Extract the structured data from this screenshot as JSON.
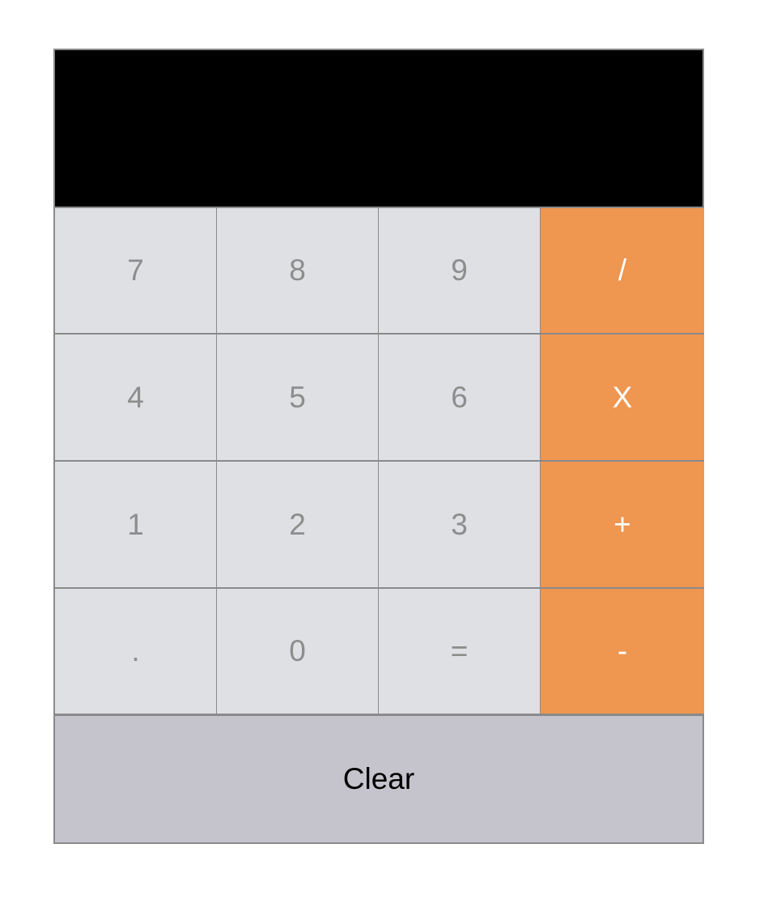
{
  "display": {
    "value": ""
  },
  "keys": [
    {
      "label": "7",
      "kind": "digit",
      "name": "key-7"
    },
    {
      "label": "8",
      "kind": "digit",
      "name": "key-8"
    },
    {
      "label": "9",
      "kind": "digit",
      "name": "key-9"
    },
    {
      "label": "/",
      "kind": "op",
      "name": "divide-button"
    },
    {
      "label": "4",
      "kind": "digit",
      "name": "key-4"
    },
    {
      "label": "5",
      "kind": "digit",
      "name": "key-5"
    },
    {
      "label": "6",
      "kind": "digit",
      "name": "key-6"
    },
    {
      "label": "X",
      "kind": "op",
      "name": "multiply-button"
    },
    {
      "label": "1",
      "kind": "digit",
      "name": "key-1"
    },
    {
      "label": "2",
      "kind": "digit",
      "name": "key-2"
    },
    {
      "label": "3",
      "kind": "digit",
      "name": "key-3"
    },
    {
      "label": "+",
      "kind": "op",
      "name": "add-button"
    },
    {
      "label": ".",
      "kind": "digit",
      "name": "decimal-button"
    },
    {
      "label": "0",
      "kind": "digit",
      "name": "key-0"
    },
    {
      "label": "=",
      "kind": "digit",
      "name": "equals-button"
    },
    {
      "label": "-",
      "kind": "op",
      "name": "subtract-button"
    }
  ],
  "clear": {
    "label": "Clear"
  },
  "colors": {
    "display_bg": "#000000",
    "digit_key_bg": "#dfe0e4",
    "digit_key_text": "#8d8d8d",
    "operator_key_bg": "#ef9651",
    "operator_key_text": "#ffffff",
    "clear_bg": "#c5c3cc",
    "border": "#8a8a8a"
  }
}
